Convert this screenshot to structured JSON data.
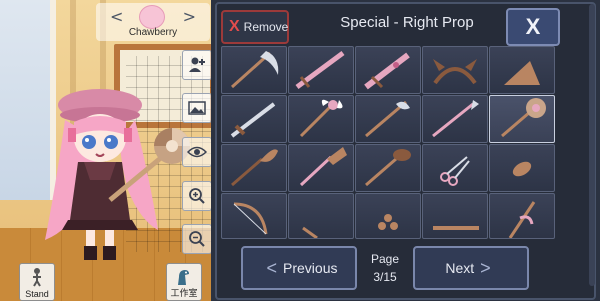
{
  "character": {
    "name": "Chawberry"
  },
  "bottom_buttons": {
    "stand_label": "Stand",
    "studio_label": "工作室"
  },
  "panel": {
    "remove_label": "Remove",
    "title": "Special - Right Prop",
    "close_label": "X",
    "prev_label": "Previous",
    "next_label": "Next",
    "page_label": "Page",
    "page_value": "3/15",
    "items": [
      {
        "icon": "scythe-icon"
      },
      {
        "icon": "sword-icon"
      },
      {
        "icon": "pink-sword-icon"
      },
      {
        "icon": "horns-headband-icon"
      },
      {
        "icon": "doorstop-wedge-icon"
      },
      {
        "icon": "dagger-icon"
      },
      {
        "icon": "winged-wand-icon"
      },
      {
        "icon": "axe-staff-icon"
      },
      {
        "icon": "pink-spear-icon"
      },
      {
        "icon": "candy-lollipop-wand-icon"
      },
      {
        "icon": "leaf-spear-icon"
      },
      {
        "icon": "broom-icon"
      },
      {
        "icon": "torch-icon"
      },
      {
        "icon": "scissors-icon"
      },
      {
        "icon": "bread-icon"
      },
      {
        "icon": "bow-icon"
      },
      {
        "icon": "partial-item-icon"
      },
      {
        "icon": "fidget-spinner-icon"
      },
      {
        "icon": "stick-icon"
      },
      {
        "icon": "ribbon-stick-icon"
      }
    ]
  }
}
